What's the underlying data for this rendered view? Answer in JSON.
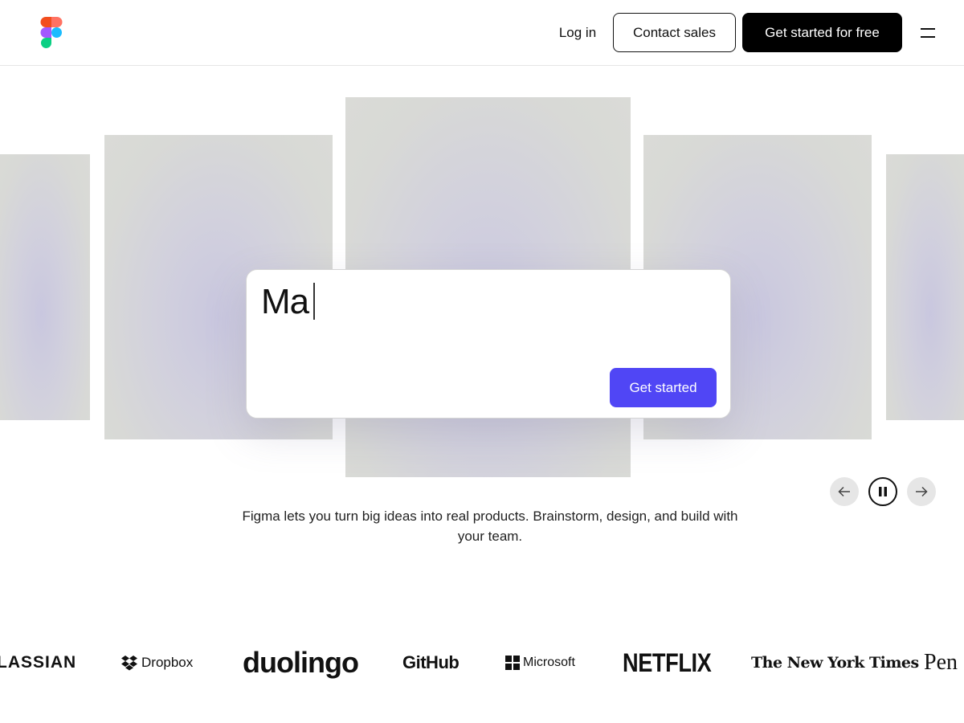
{
  "header": {
    "logo_icon": "figma-logo-icon",
    "login_label": "Log in",
    "contact_label": "Contact sales",
    "cta_label": "Get started for free",
    "menu_icon": "hamburger-menu-icon"
  },
  "hero": {
    "prompt_text": "Ma",
    "start_label": "Get started",
    "accent_color": "#5046f5",
    "controls": {
      "prev_icon": "arrow-left-icon",
      "pause_icon": "pause-icon",
      "next_icon": "arrow-right-icon"
    }
  },
  "tagline": {
    "line1": "Figma lets you turn big ideas into real products. Brainstorm, design, and build with",
    "line2": "your team."
  },
  "logos": {
    "atlassian": "LASSIAN",
    "dropbox": "Dropbox",
    "duolingo": "duolingo",
    "github": "GitHub",
    "microsoft": "Microsoft",
    "netflix": "NETFLIX",
    "nyt": "The New York Times",
    "pentagram": "Pen"
  }
}
